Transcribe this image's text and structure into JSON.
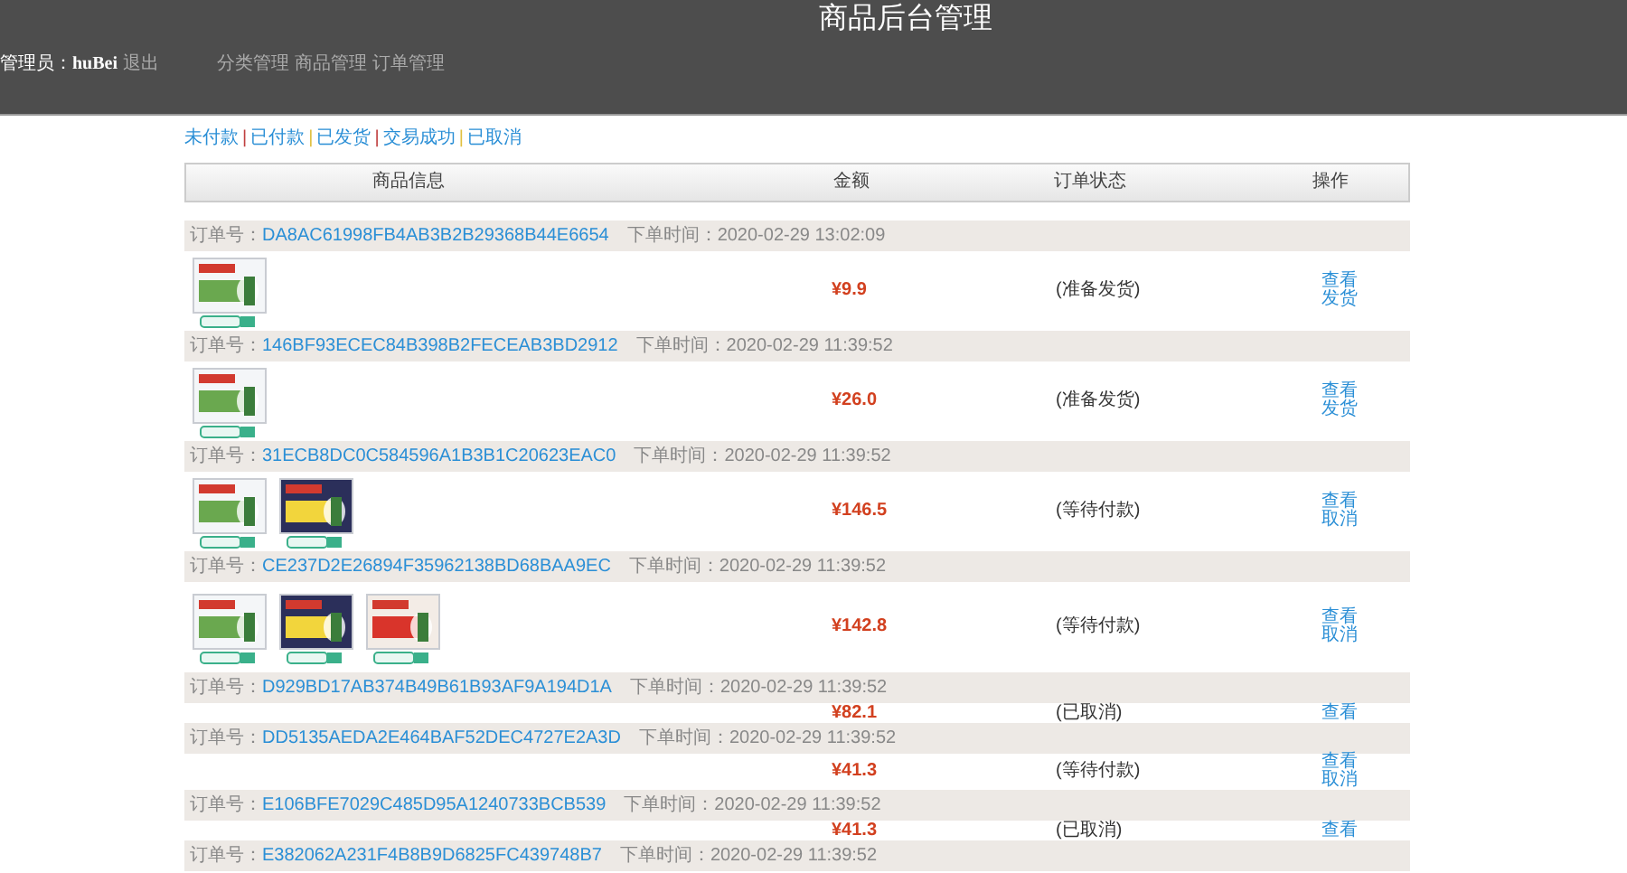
{
  "header": {
    "title": "商品后台管理",
    "admin_label": "管理员：",
    "admin_name": "huBei",
    "logout": "退出",
    "nav": [
      "分类管理",
      "商品管理",
      "订单管理"
    ]
  },
  "filters": [
    {
      "label": "未付款",
      "separator": "|"
    },
    {
      "label": "已付款",
      "separator": "|"
    },
    {
      "label": "已发货",
      "separator": "|"
    },
    {
      "label": "交易成功",
      "separator": "|"
    },
    {
      "label": "已取消"
    }
  ],
  "table": {
    "columns": [
      "商品信息",
      "金额",
      "订单状态",
      "操作"
    ],
    "orders": [
      {
        "number_label": "订单号：",
        "number": "DA8AC61998FB4AB3B2B29368B44E6654",
        "time_label": "下单时间：",
        "time": "2020-02-29 13:02:09",
        "products": [
          {
            "kind": "picture"
          }
        ],
        "amount": "¥9.9",
        "status": "(准备发货)",
        "actions": [
          "查看",
          "发货"
        ]
      },
      {
        "number_label": "订单号：",
        "number": "146BF93ECEC84B398B2FECEAB3BD2912",
        "time_label": "下单时间：",
        "time": "2020-02-29 11:39:52",
        "products": [
          {
            "kind": "picture"
          }
        ],
        "amount": "¥26.0",
        "status": "(准备发货)",
        "actions": [
          "查看",
          "发货"
        ]
      },
      {
        "number_label": "订单号：",
        "number": "31ECB8DC0C584596A1B3B1C20623EAC0",
        "time_label": "下单时间：",
        "time": "2020-02-29 11:39:52",
        "products": [
          {
            "kind": "picture"
          },
          {
            "kind": "picture"
          }
        ],
        "amount": "¥146.5",
        "status": "(等待付款)",
        "actions": [
          "查看",
          "取消"
        ]
      },
      {
        "number_label": "订单号：",
        "number": "CE237D2E26894F35962138BD68BAA9EC",
        "time_label": "下单时间：",
        "time": "2020-02-29 11:39:52",
        "products": [
          {
            "kind": "picture"
          },
          {
            "kind": "picture"
          },
          {
            "kind": "picture"
          }
        ],
        "amount": "¥142.8",
        "status": "(等待付款)",
        "actions": [
          "查看",
          "取消"
        ]
      },
      {
        "number_label": "订单号：",
        "number": "D929BD17AB374B49B61B93AF9A194D1A",
        "time_label": "下单时间：",
        "time": "2020-02-29 11:39:52",
        "amount": "¥82.1",
        "status": "(已取消)",
        "actions": [
          "查看"
        ]
      },
      {
        "number_label": "订单号：",
        "number": "DD5135AEDA2E464BAF52DEC4727E2A3D",
        "time_label": "下单时间：",
        "time": "2020-02-29 11:39:52",
        "amount": "¥41.3",
        "status": "(等待付款)",
        "actions": [
          "查看",
          "取消"
        ]
      },
      {
        "number_label": "订单号：",
        "number": "E106BFE7029C485D95A1240733BCB539",
        "time_label": "下单时间：",
        "time": "2020-02-29 11:39:52",
        "amount": "¥41.3",
        "status": "(已取消)",
        "actions": [
          "查看"
        ]
      },
      {
        "number_label": "订单号：",
        "number": "E382062A231F4B8B9D6825FC439748B7",
        "time_label": "下单时间：",
        "time": "2020-02-29 11:39:52"
      }
    ]
  }
}
